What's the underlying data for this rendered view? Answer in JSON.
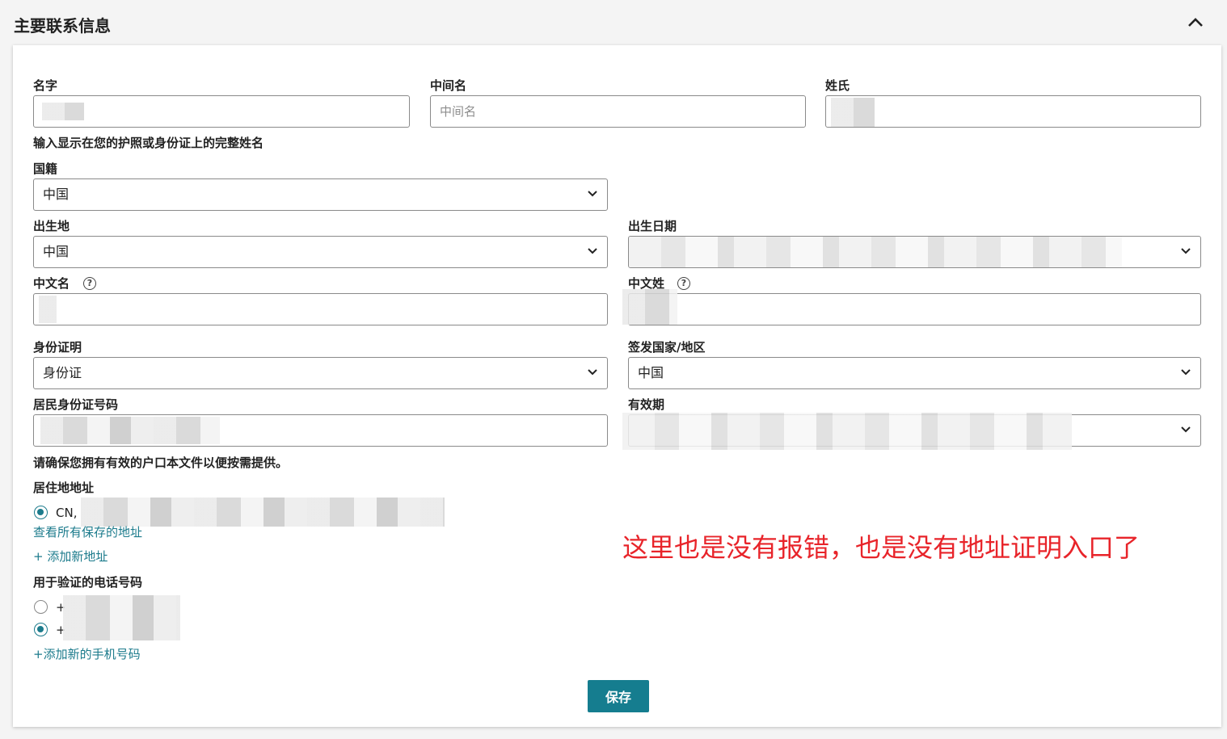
{
  "section": {
    "title": "主要联系信息"
  },
  "name_fields": {
    "first_label": "名字",
    "middle_label": "中间名",
    "middle_placeholder": "中间名",
    "last_label": "姓氏",
    "help_text": "输入显示在您的护照或身份证上的完整姓名"
  },
  "nationality": {
    "label": "国籍",
    "value": "中国"
  },
  "birthplace": {
    "label": "出生地",
    "value": "中国"
  },
  "birthdate": {
    "label": "出生日期"
  },
  "chinese_given_name": {
    "label": "中文名"
  },
  "chinese_surname": {
    "label": "中文姓"
  },
  "id_type": {
    "label": "身份证明",
    "value": "身份证"
  },
  "issuing_country": {
    "label": "签发国家/地区",
    "value": "中国"
  },
  "id_number": {
    "label": "居民身份证号码"
  },
  "expiry": {
    "label": "有效期"
  },
  "id_help_text": "请确保您拥有有效的户口本文件以便按需提供。",
  "address": {
    "label": "居住地地址",
    "option_prefix": "CN,",
    "view_all_link": "查看所有保存的地址",
    "add_link": "+ 添加新地址"
  },
  "phone": {
    "label": "用于验证的电话号码",
    "options": [
      {
        "prefix": "+",
        "selected": false
      },
      {
        "prefix": "+",
        "selected": true
      }
    ],
    "add_link": "+添加新的手机号码"
  },
  "actions": {
    "save_label": "保存"
  },
  "annotation": {
    "text": "这里也是没有报错，也是没有地址证明入口了"
  },
  "colors": {
    "accent": "#157d8f",
    "annotation": "#e8242a"
  },
  "icons": {
    "collapse": "chevron-up-icon",
    "dropdown": "chevron-down-icon",
    "help": "question-circle-icon"
  }
}
